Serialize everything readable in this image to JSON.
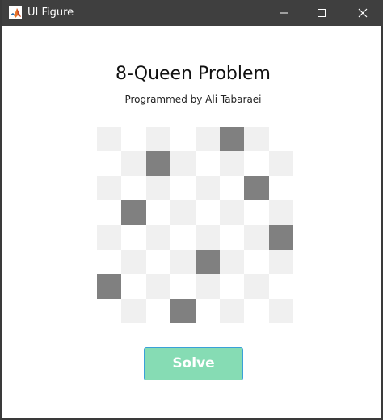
{
  "window": {
    "title": "UI Figure",
    "icon": "matlab-icon",
    "controls": [
      "minimize-icon",
      "maximize-icon",
      "close-icon"
    ]
  },
  "main": {
    "heading": "8-Queen Problem",
    "subheading": "Programmed by Ali Tabaraei",
    "solve_label": "Solve"
  },
  "board": {
    "size": 8,
    "queens": [
      [
        0,
        5
      ],
      [
        1,
        2
      ],
      [
        2,
        6
      ],
      [
        3,
        1
      ],
      [
        4,
        7
      ],
      [
        5,
        4
      ],
      [
        6,
        0
      ],
      [
        7,
        3
      ]
    ]
  },
  "colors": {
    "titlebar": "#3f3f3f",
    "light_square": "#f0f0f0",
    "white_square": "#ffffff",
    "queen_square": "#808080",
    "button_fill": "#86dcb4",
    "button_border": "#3aa0d8"
  }
}
